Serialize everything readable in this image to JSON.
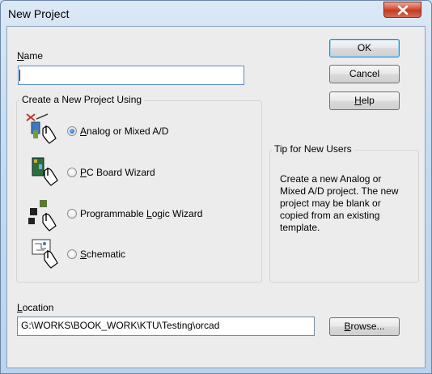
{
  "window": {
    "title": "New Project"
  },
  "name": {
    "label_prefix": "N",
    "label_rest": "ame",
    "value": ""
  },
  "buttons": {
    "ok": "OK",
    "cancel": "Cancel",
    "help_prefix": "H",
    "help_rest": "elp",
    "browse_prefix": "B",
    "browse_rest": "rowse..."
  },
  "project_group": {
    "title": "Create a New Project Using",
    "options": [
      {
        "prefix": "A",
        "rest": "nalog or Mixed A/D",
        "selected": true,
        "icon": "analog-mixed-icon"
      },
      {
        "prefix": "P",
        "rest": "C Board Wizard",
        "selected": false,
        "icon": "pc-board-wizard-icon"
      },
      {
        "pre": "Programmable ",
        "prefix": "L",
        "rest": "ogic Wizard",
        "selected": false,
        "icon": "programmable-logic-icon"
      },
      {
        "prefix": "S",
        "rest": "chematic",
        "selected": false,
        "icon": "schematic-icon"
      }
    ]
  },
  "tip": {
    "title": "Tip for New Users",
    "text": "Create a new Analog or\nMixed A/D project.  The new\nproject may be blank or\ncopied from an existing\ntemplate."
  },
  "location": {
    "label_prefix": "L",
    "label_rest": "ocation",
    "value": "G:\\WORKS\\BOOK_WORK\\KTU\\Testing\\orcad"
  }
}
